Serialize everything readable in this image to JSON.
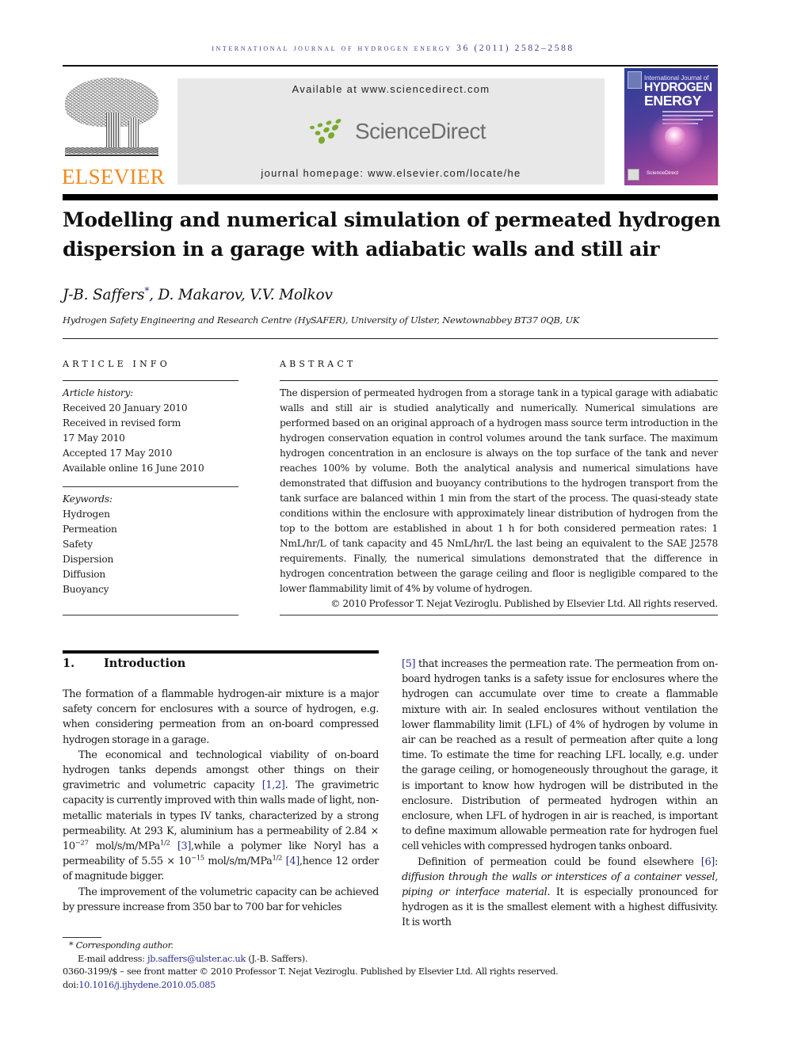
{
  "running_head": "International Journal of Hydrogen Energy 36 (2011) 2582–2588",
  "publisher": {
    "name": "ELSEVIER",
    "brand_color": "#f08a1c"
  },
  "banner": {
    "available_at": "Available at www.sciencedirect.com",
    "logo_text": "ScienceDirect",
    "logo_dot_color": "#7aab2a",
    "homepage": "journal homepage: www.elsevier.com/locate/he"
  },
  "cover": {
    "line1": "International Journal of",
    "line2": "HYDROGEN",
    "line3": "ENERGY",
    "footer": "ScienceDirect"
  },
  "article": {
    "title_line1": "Modelling and numerical simulation of permeated hydrogen",
    "title_line2": "dispersion in a garage with adiabatic walls and still air",
    "authors_part1": "J-B. Saffers",
    "author_mark": "*",
    "authors_part2": ", D. Makarov, V.V. Molkov",
    "affiliation": "Hydrogen Safety Engineering and Research Centre (HySAFER), University of Ulster, Newtownabbey BT37 0QB, UK"
  },
  "article_info": {
    "heading": "ARTICLE INFO",
    "history_label": "Article history:",
    "history": [
      "Received 20 January 2010",
      "Received in revised form",
      "17 May 2010",
      "Accepted 17 May 2010",
      "Available online 16 June 2010"
    ],
    "keywords_label": "Keywords:",
    "keywords": [
      "Hydrogen",
      "Permeation",
      "Safety",
      "Dispersion",
      "Diffusion",
      "Buoyancy"
    ]
  },
  "abstract": {
    "heading": "ABSTRACT",
    "text": "The dispersion of permeated hydrogen from a storage tank in a typical garage with adiabatic walls and still air is studied analytically and numerically. Numerical simulations are performed based on an original approach of a hydrogen mass source term introduction in the hydrogen conservation equation in control volumes around the tank surface. The maximum hydrogen concentration in an enclosure is always on the top surface of the tank and never reaches 100% by volume. Both the analytical analysis and numerical simulations have demonstrated that diffusion and buoyancy contributions to the hydrogen transport from the tank surface are balanced within 1 min from the start of the process. The quasi-steady state conditions within the enclosure with approximately linear distribution of hydrogen from the top to the bottom are established in about 1 h for both considered permeation rates: 1 NmL/hr/L of tank capacity and 45 NmL/hr/L the last being an equivalent to the SAE J2578 requirements. Finally, the numerical simulations demonstrated that the difference in hydrogen concentration between the garage ceiling and floor is negligible compared to the lower flammability limit of 4% by volume of hydrogen.",
    "copyright": "© 2010 Professor T. Nejat Veziroglu. Published by Elsevier Ltd. All rights reserved."
  },
  "introduction": {
    "number": "1.",
    "heading": "Introduction",
    "p1": "The formation of a flammable hydrogen-air mixture is a major safety concern for enclosures with a source of hydrogen, e.g. when considering permeation from an on-board compressed hydrogen storage in a garage.",
    "p2_a": "The economical and technological viability of on-board hydrogen tanks depends amongst other things on their gravimetric and volumetric capacity ",
    "p2_ref1": "[1,2]",
    "p2_b": ". The gravimetric capacity is currently improved with thin walls made of light, non-metallic materials in types IV tanks, characterized by a strong permeability. At 293 K, aluminium has a permeability of 2.84 × 10",
    "p2_exp1": "−27",
    "p2_c": " mol/s/m/MPa",
    "p2_half1": "1/2",
    "p2_ref3": "[3]",
    "p2_d": ",while a polymer like Noryl has a permeability of 5.55 × 10",
    "p2_exp2": "−15",
    "p2_e": " mol/s/m/MPa",
    "p2_half2": "1/2",
    "p2_ref4": "[4]",
    "p2_f": ",hence 12 order of magnitude bigger.",
    "p3": "The improvement of the volumetric capacity can be achieved by pressure increase from 350 bar to 700 bar for vehicles ",
    "p3_ref5": "[5]",
    "p3_b": " that increases the permeation rate. The permeation from on-board hydrogen tanks is a safety issue for enclosures where the hydrogen can accumulate over time to create a flammable mixture with air. In sealed enclosures without ventilation the lower flammability limit (LFL) of 4% of hydrogen by volume in air can be reached as a result of permeation after quite a long time. To estimate the time for reaching LFL locally, e.g. under the garage ceiling, or homogeneously throughout the garage, it is important to know how hydrogen will be distributed in the enclosure. Distribution of permeated hydrogen within an enclosure, when LFL of hydrogen in air is reached, is important to define maximum allowable permeation rate for hydrogen fuel cell vehicles with compressed hydrogen tanks onboard.",
    "p4_a": "Definition of permeation could be found elsewhere ",
    "p4_ref6": "[6]",
    "p4_b": ": ",
    "p4_italic": "diffusion through the walls or interstices of a container vessel, piping or interface material",
    "p4_c": ". It is especially pronounced for hydrogen as it is the smallest element with a highest diffusivity. It is worth"
  },
  "footnotes": {
    "mark": "*",
    "corresponding": "Corresponding author.",
    "email_label": "E-mail address: ",
    "email": "jb.saffers@ulster.ac.uk",
    "email_owner": " (J.-B. Saffers).",
    "front_matter": "0360-3199/$ – see front matter © 2010 Professor T. Nejat Veziroglu. Published by Elsevier Ltd. All rights reserved.",
    "doi_label": "doi:",
    "doi": "10.1016/j.ijhydene.2010.05.085"
  }
}
